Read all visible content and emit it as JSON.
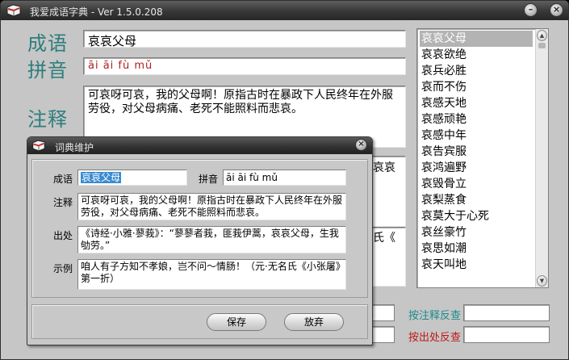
{
  "window": {
    "title": "我爱成语字典 - Ver 1.5.0.208"
  },
  "labels": {
    "idiom": "成语",
    "pinyin": "拼音",
    "meaning": "注释"
  },
  "idiom": {
    "value": "哀哀父母"
  },
  "pinyin": {
    "value": "āi  āi  fù  mǔ"
  },
  "meaning": {
    "value": "可哀呀可哀，我的父母啊！原指古时在暴政下人民终年在外服劳役，对父母病痛、老死不能照料而悲哀。"
  },
  "source_peek": {
    "value": "哀哀"
  },
  "example_peek": {
    "value": "氏《"
  },
  "list": {
    "items": [
      "哀哀父母",
      "哀哀欲绝",
      "哀兵必胜",
      "哀而不伤",
      "哀感天地",
      "哀感顽艳",
      "哀感中年",
      "哀告宾服",
      "哀鸿遍野",
      "哀毁骨立",
      "哀梨蒸食",
      "哀莫大于心死",
      "哀丝豪竹",
      "哀思如潮",
      "哀天叫地"
    ],
    "selected_index": 0
  },
  "reverse": {
    "by_meaning": "按注释反查",
    "by_source": "按出处反查"
  },
  "dialog": {
    "title": "词典维护",
    "labels": {
      "idiom": "成语",
      "pinyin": "拼音",
      "meaning": "注释",
      "source": "出处",
      "example": "示例"
    },
    "idiom": "哀哀父母",
    "pinyin": "āi  āi  fù  mǔ",
    "meaning": "可哀呀可哀，我的父母啊！原指古时在暴政下人民终年在外服劳役，对父母病痛、老死不能照料而悲哀。",
    "source": "《诗经·小雅·蓼莪》：“蓼蓼者莪，匪莪伊蒿，哀哀父母，生我劬劳。”",
    "example": "咱人有子方知不孝娘，岂不问～情肠！（元·无名氏《小张屠》第一折）",
    "save": "保存",
    "discard": "放弃"
  },
  "colors": {
    "label_teal": "#2d7d7d",
    "pinyin_red": "#b01e1e",
    "reverse_by_meaning": "#1f8a8a",
    "reverse_by_source": "#c01818",
    "dialog_highlight": "#3a8bd0"
  },
  "icons": {
    "app": "book-icon",
    "minimize": "minimize-icon",
    "close": "close-icon",
    "dialog_close": "close-icon"
  }
}
